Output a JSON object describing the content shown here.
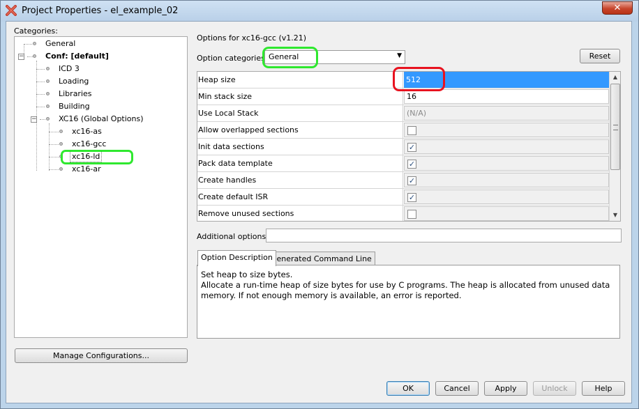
{
  "window": {
    "title": "Project Properties - el_example_02",
    "close_glyph": "✕"
  },
  "categories": {
    "label": "Categories:",
    "tree": [
      {
        "label": "General",
        "bold": false
      },
      {
        "label": "Conf: [default]",
        "bold": true
      },
      {
        "label": "ICD 3",
        "bold": false
      },
      {
        "label": "Loading",
        "bold": false
      },
      {
        "label": "Libraries",
        "bold": false
      },
      {
        "label": "Building",
        "bold": false
      },
      {
        "label": "XC16 (Global Options)",
        "bold": false
      },
      {
        "label": "xc16-as",
        "bold": false
      },
      {
        "label": "xc16-gcc",
        "bold": false
      },
      {
        "label": "xc16-ld",
        "bold": false,
        "selected": true
      },
      {
        "label": "xc16-ar",
        "bold": false
      }
    ],
    "manage_button": "Manage Configurations..."
  },
  "options": {
    "header": "Options for xc16-gcc (v1.21)",
    "category_label": "Option categories:",
    "category_value": "General",
    "reset_button": "Reset",
    "rows": [
      {
        "name": "Heap size",
        "value": "512",
        "kind": "selected"
      },
      {
        "name": "Min stack size",
        "value": "16",
        "kind": "input"
      },
      {
        "name": "Use Local Stack",
        "value": "(N/A)",
        "kind": "disabled"
      },
      {
        "name": "Allow overlapped sections",
        "checked": false,
        "kind": "check"
      },
      {
        "name": "Init data sections",
        "checked": true,
        "kind": "check"
      },
      {
        "name": "Pack data template",
        "checked": true,
        "kind": "check"
      },
      {
        "name": "Create handles",
        "checked": true,
        "kind": "check"
      },
      {
        "name": "Create default ISR",
        "checked": true,
        "kind": "check"
      },
      {
        "name": "Remove unused sections",
        "checked": false,
        "kind": "check"
      }
    ],
    "additional_label": "Additional options:",
    "additional_value": ""
  },
  "tabs": [
    {
      "label": "Option Description",
      "active": true
    },
    {
      "label": "Generated Command Line",
      "active": false
    }
  ],
  "description": {
    "line1": "Set heap to size bytes.",
    "line2": "Allocate a run-time heap of size bytes for use by C programs. The heap is allocated from unused data memory. If not enough memory is available, an error is reported."
  },
  "buttons": {
    "ok": "OK",
    "cancel": "Cancel",
    "apply": "Apply",
    "unlock": "Unlock",
    "help": "Help"
  },
  "icons": {
    "app": "project-x-icon",
    "check": "✓",
    "combo_arrow": "▼",
    "scroll_up": "▲",
    "scroll_down": "▼"
  },
  "colors": {
    "selection": "#3399ff",
    "highlight_green": "#2fe82f",
    "highlight_red": "#e8121f"
  }
}
